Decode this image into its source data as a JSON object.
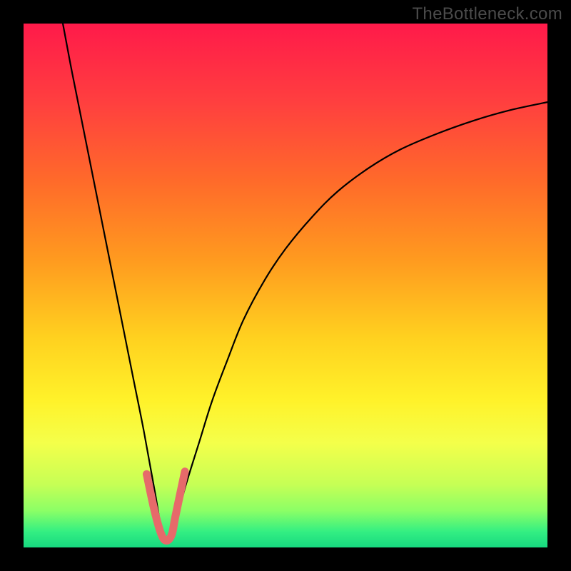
{
  "watermark": "TheBottleneck.com",
  "chart_data": {
    "type": "line",
    "title": "",
    "xlabel": "",
    "ylabel": "",
    "xlim": [
      0,
      100
    ],
    "ylim": [
      0,
      100
    ],
    "note": "Bottleneck-style V-curve with gradient background (red top → green bottom). No numeric axes/ticks shown. X and Y values are read as percent of the inner 734×734 plot area; Y shown with 0 at bottom. Minimum (dip) near x≈27%, y≈0%. A short salmon V marker is drawn at the dip.",
    "series": [
      {
        "name": "curve",
        "x": [
          7.5,
          9.0,
          11.0,
          13.0,
          15.0,
          17.0,
          19.0,
          21.0,
          23.0,
          25.0,
          27.0,
          29.0,
          31.0,
          33.5,
          36.0,
          39.0,
          42.0,
          46.0,
          50.0,
          55.0,
          60.0,
          66.0,
          72.0,
          79.0,
          86.0,
          93.0,
          100.0
        ],
        "y": [
          100.0,
          92.0,
          82.0,
          72.0,
          62.0,
          52.0,
          42.0,
          32.0,
          22.0,
          11.0,
          1.0,
          5.0,
          12.0,
          20.0,
          28.0,
          36.0,
          43.5,
          51.0,
          57.0,
          63.0,
          68.0,
          72.5,
          76.0,
          79.0,
          81.5,
          83.5,
          85.0
        ]
      }
    ],
    "dip_marker": {
      "color": "#e66a6a",
      "points_x": [
        23.5,
        25.0,
        26.3,
        27.3,
        28.3,
        29.0,
        30.8
      ],
      "points_y": [
        14.0,
        7.0,
        2.5,
        1.3,
        2.5,
        6.0,
        14.5
      ]
    },
    "gradient_stops": [
      {
        "pos": 0.0,
        "color": "#ff1a4a"
      },
      {
        "pos": 0.15,
        "color": "#ff3f3f"
      },
      {
        "pos": 0.3,
        "color": "#ff6a2a"
      },
      {
        "pos": 0.45,
        "color": "#ff9a1f"
      },
      {
        "pos": 0.6,
        "color": "#ffd11f"
      },
      {
        "pos": 0.72,
        "color": "#fff22a"
      },
      {
        "pos": 0.8,
        "color": "#f4ff4a"
      },
      {
        "pos": 0.88,
        "color": "#c6ff55"
      },
      {
        "pos": 0.93,
        "color": "#8bff66"
      },
      {
        "pos": 0.97,
        "color": "#33ef82"
      },
      {
        "pos": 1.0,
        "color": "#17d980"
      }
    ]
  }
}
